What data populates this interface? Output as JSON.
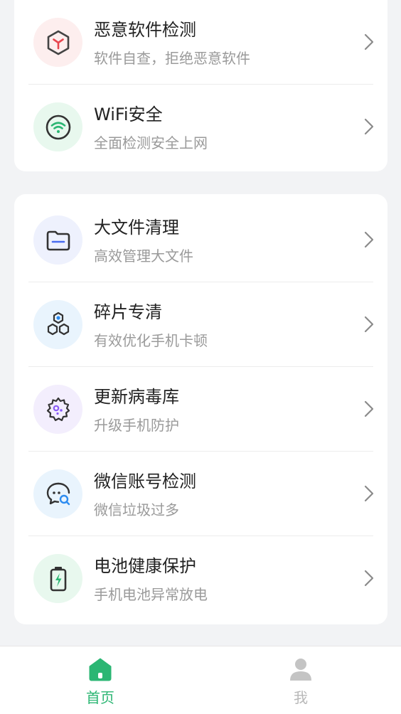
{
  "security_card": {
    "items": [
      {
        "title": "恶意软件检测",
        "subtitle": "软件自查，拒绝恶意软件",
        "icon": "malware-shield-icon"
      },
      {
        "title": "WiFi安全",
        "subtitle": "全面检测安全上网",
        "icon": "wifi-icon"
      }
    ]
  },
  "tools_card": {
    "items": [
      {
        "title": "大文件清理",
        "subtitle": "高效管理大文件",
        "icon": "folder-icon"
      },
      {
        "title": "碎片专清",
        "subtitle": "有效优化手机卡顿",
        "icon": "hexagons-icon"
      },
      {
        "title": "更新病毒库",
        "subtitle": "升级手机防护",
        "icon": "virus-gear-icon"
      },
      {
        "title": "微信账号检测",
        "subtitle": "微信垃圾过多",
        "icon": "chat-search-icon"
      },
      {
        "title": "电池健康保护",
        "subtitle": "手机电池异常放电",
        "icon": "battery-icon"
      }
    ]
  },
  "tabbar": {
    "home_label": "首页",
    "me_label": "我",
    "active": "home"
  },
  "colors": {
    "accent": "#2bb673",
    "inactive": "#b8b8b8",
    "background": "#f2f3f5"
  }
}
